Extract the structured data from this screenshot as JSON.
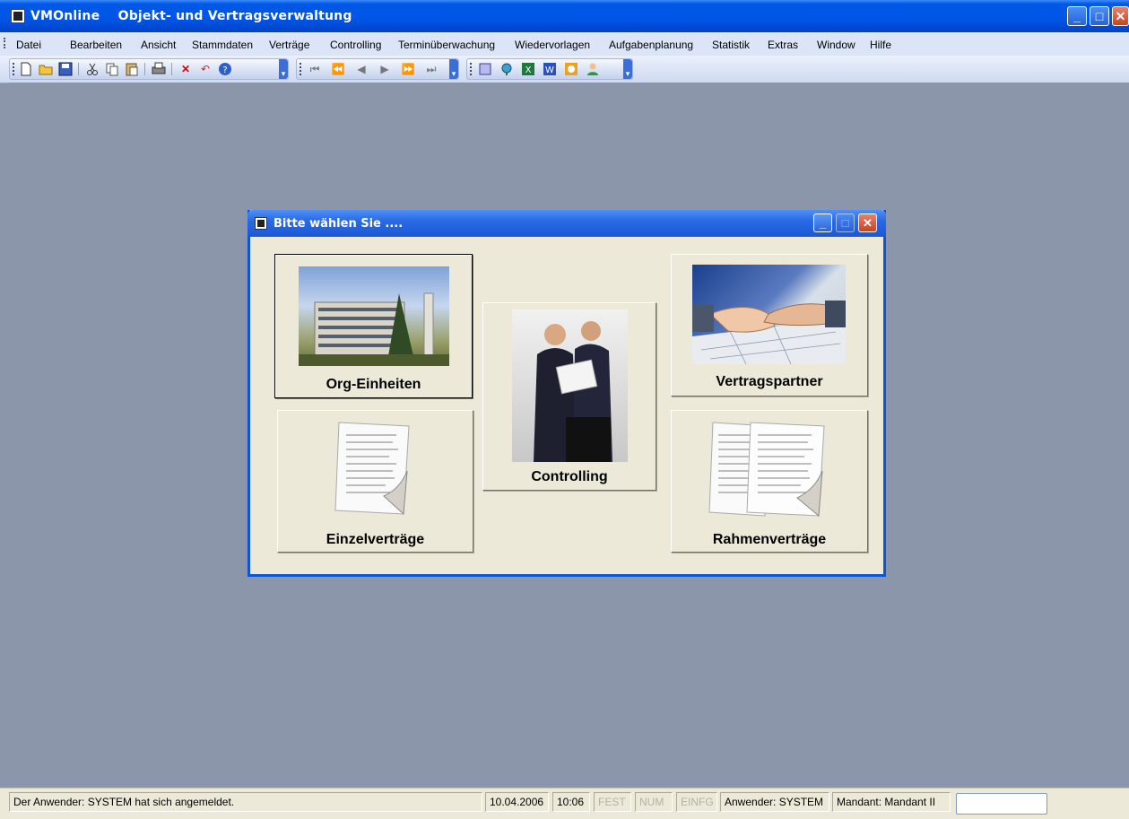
{
  "app": {
    "title": "VMOnline    Objekt- und Vertragsverwaltung",
    "minimize": "_",
    "maximize": "□",
    "close": "✕"
  },
  "menubar": {
    "items": [
      {
        "label": "Datei"
      },
      {
        "label": "Bearbeiten"
      },
      {
        "label": "Ansicht"
      },
      {
        "label": "Stammdaten"
      },
      {
        "label": "Verträge"
      },
      {
        "label": "Controlling"
      },
      {
        "label": "Terminüberwachung"
      },
      {
        "label": "Wiedervorlagen"
      },
      {
        "label": "Aufgabenplanung"
      },
      {
        "label": "Statistik"
      },
      {
        "label": "Extras"
      },
      {
        "label": "Window"
      },
      {
        "label": "Hilfe"
      }
    ]
  },
  "toolbar": {
    "groups": [
      {
        "buttons": [
          "new-icon",
          "open-folder-icon",
          "save-icon",
          "cut-icon",
          "copy-icon",
          "paste-icon",
          "print-icon",
          "delete-icon",
          "undo-icon",
          "help-icon"
        ]
      },
      {
        "buttons": [
          "first-record-icon",
          "prev-page-icon",
          "prev-record-icon",
          "next-record-icon",
          "next-page-icon",
          "last-record-icon"
        ]
      },
      {
        "buttons": [
          "notes-icon",
          "globe-icon",
          "excel-icon",
          "word-icon",
          "outlook-icon",
          "user-icon"
        ]
      }
    ]
  },
  "dialog": {
    "title": "Bitte wählen Sie ....",
    "buttons": {
      "org": "Org-Einheiten",
      "controlling": "Controlling",
      "partner": "Vertragspartner",
      "einzel": "Einzelverträge",
      "rahmen": "Rahmenverträge"
    }
  },
  "statusbar": {
    "message": "Der Anwender:  SYSTEM hat sich angemeldet.",
    "date": "10.04.2006",
    "time": "10:06",
    "fest": "FEST",
    "num": "NUM",
    "einfg": "EINFG",
    "user": "Anwender: SYSTEM",
    "mandant": "Mandant: Mandant II"
  }
}
